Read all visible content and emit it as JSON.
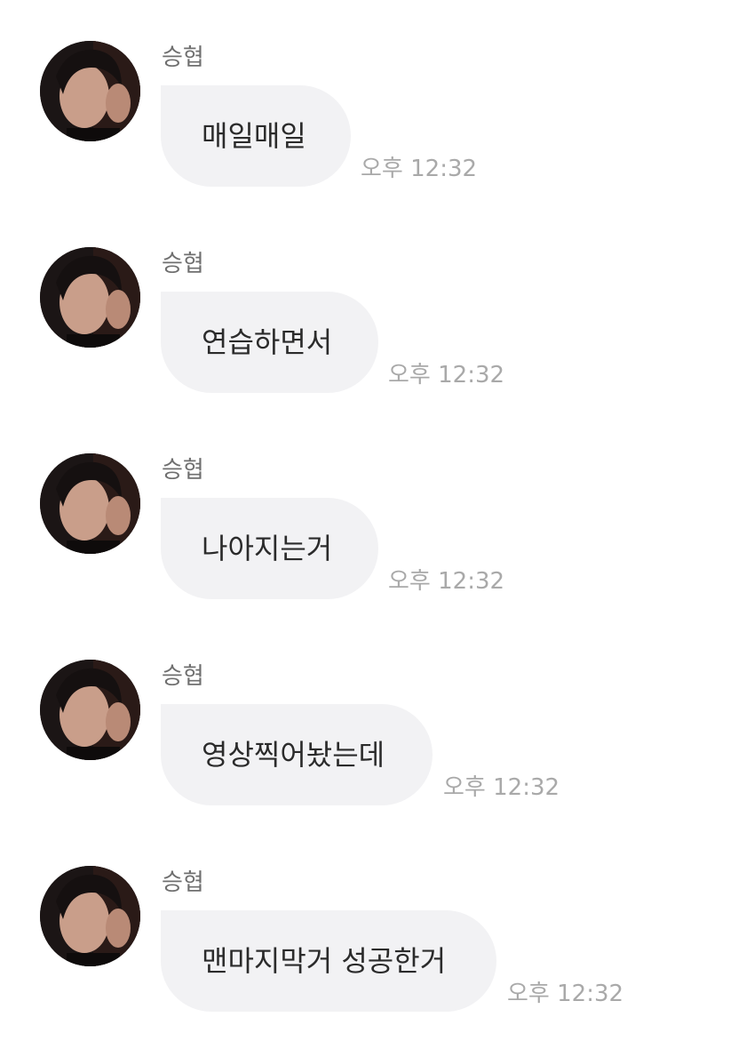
{
  "sender_name": "승협",
  "messages": [
    {
      "text": "매일매일",
      "time": "오후 12:32"
    },
    {
      "text": "연습하면서",
      "time": "오후 12:32"
    },
    {
      "text": "나아지는거",
      "time": "오후 12:32"
    },
    {
      "text": "영상찍어놨는데",
      "time": "오후 12:32"
    },
    {
      "text": "맨마지막거 성공한거",
      "time": "오후 12:32"
    }
  ],
  "colors": {
    "bubble": "#f2f2f4",
    "message_text": "#2b2b2b",
    "sender_text": "#6f6f6f",
    "time_text": "#a9a9a9"
  }
}
